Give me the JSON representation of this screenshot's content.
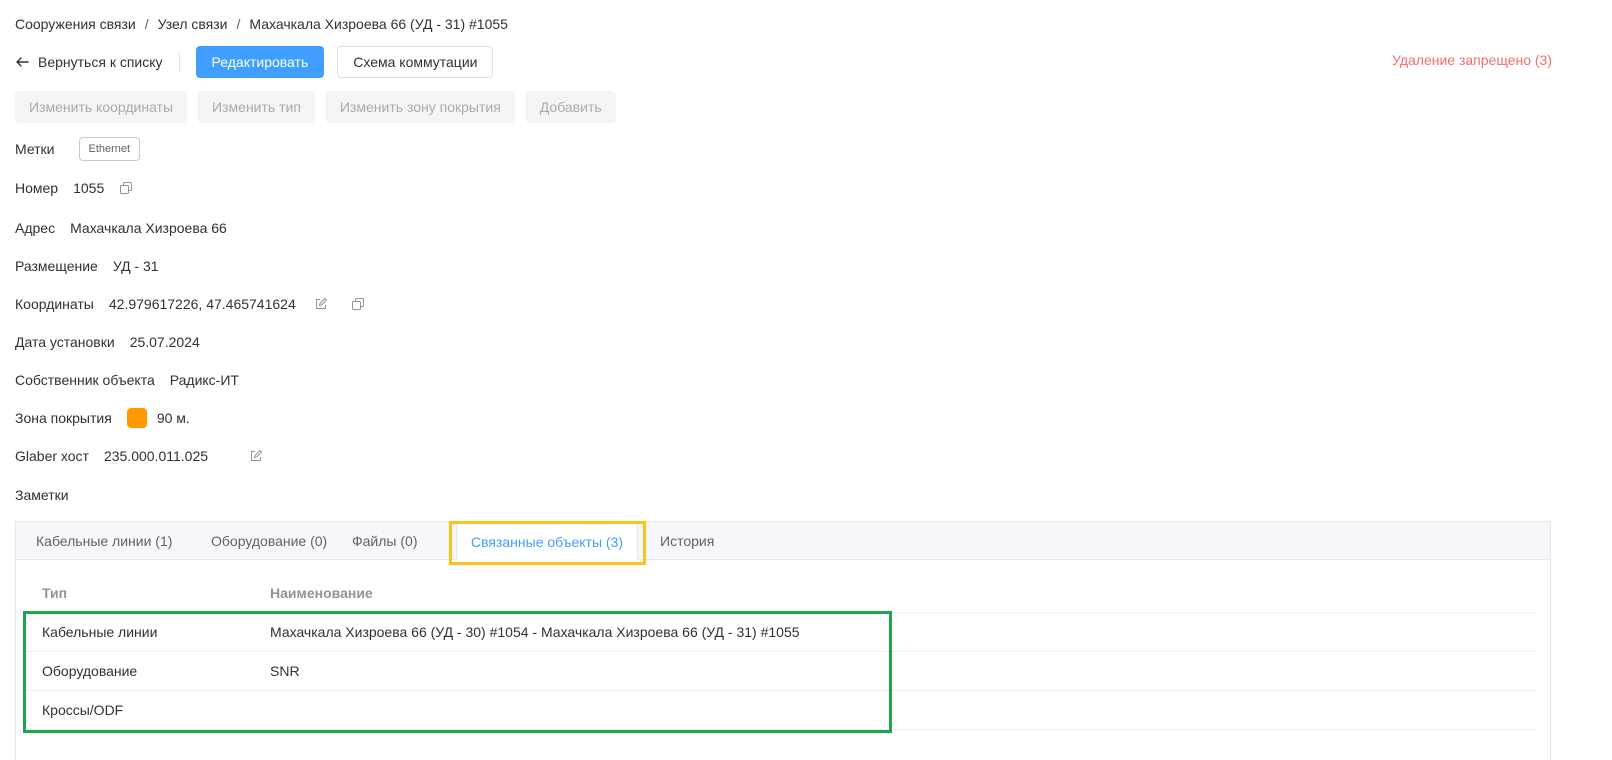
{
  "breadcrumb": [
    "Сооружения связи",
    "Узел связи",
    "Махачкала Хизроева 66 (УД - 31) #1055"
  ],
  "toolbar": {
    "back_label": "Вернуться к списку",
    "edit_label": "Редактировать",
    "scheme_label": "Схема коммутации",
    "delete_note": "Удаление запрещено (3)"
  },
  "actions": [
    "Изменить координаты",
    "Изменить тип",
    "Изменить зону покрытия",
    "Добавить"
  ],
  "fields": {
    "tags": {
      "label": "Метки",
      "value": "Ethernet"
    },
    "number": {
      "label": "Номер",
      "value": "1055"
    },
    "address": {
      "label": "Адрес",
      "value": "Махачкала Хизроева 66"
    },
    "placement": {
      "label": "Размещение",
      "value": "УД - 31"
    },
    "coords": {
      "label": "Координаты",
      "value": "42.979617226, 47.465741624"
    },
    "install_date": {
      "label": "Дата установки",
      "value": "25.07.2024"
    },
    "owner": {
      "label": "Собственник объекта",
      "value": "Радикс-ИТ"
    },
    "coverage": {
      "label": "Зона покрытия",
      "value": "90 м.",
      "color": "#ff9900"
    },
    "glaber": {
      "label": "Glaber хост",
      "value": "235.000.011.025"
    },
    "notes": {
      "label": "Заметки"
    }
  },
  "tabs": [
    "Кабельные линии (1)",
    "Оборудование (0)",
    "Файлы (0)",
    "Связанные объекты (3)",
    "История"
  ],
  "active_tab": "Связанные объекты (3)",
  "table": {
    "headers": [
      "Тип",
      "Наименование"
    ],
    "rows": [
      [
        "Кабельные линии",
        "Махачкала Хизроева 66 (УД - 30) #1054 - Махачкала Хизроева 66 (УД - 31) #1055"
      ],
      [
        "Оборудование",
        "SNR"
      ],
      [
        "Кроссы/ODF",
        ""
      ]
    ]
  },
  "colors": {
    "primary": "#409eff",
    "danger": "#f56c6c",
    "highlight_yellow": "#fcc419",
    "highlight_green": "#1aa84c"
  }
}
